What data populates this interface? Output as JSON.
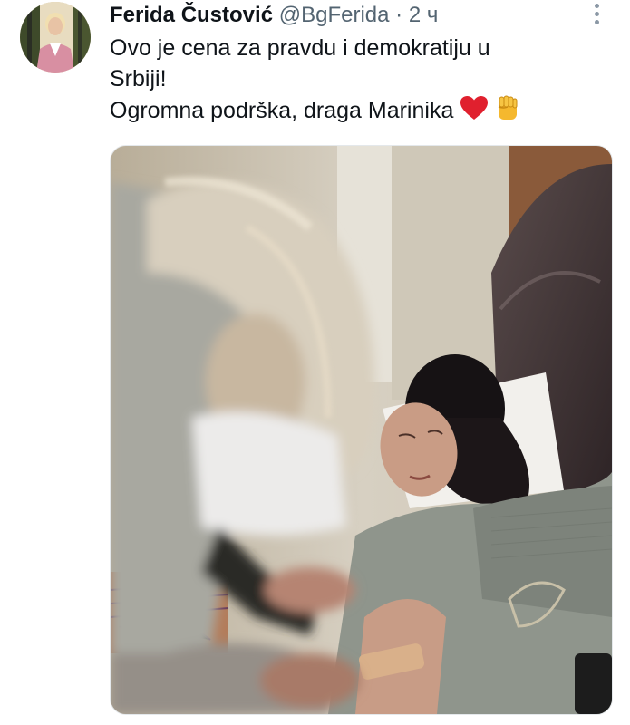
{
  "tweet": {
    "author_name": "Ferida Čustović",
    "handle": "@BgFerida",
    "separator": "·",
    "time": "2 ч",
    "text_lines": [
      "Ovo je cena za pravdu i demokratiju u",
      "Srbiji!",
      "Ogromna podrška, draga Marinika"
    ]
  },
  "icons": {
    "avatar": "profile-photo",
    "more": "more-vertical-icon",
    "heart": "red-heart-emoji",
    "fist": "raised-fist-emoji"
  },
  "colors": {
    "name": "#0f1419",
    "secondary": "#536471",
    "heart": "#e0202e",
    "fist": "#f5b82e"
  }
}
